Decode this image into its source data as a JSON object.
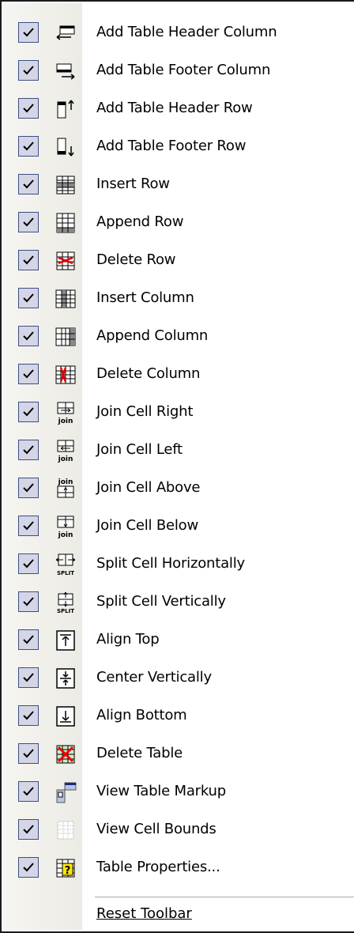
{
  "menu": {
    "items": [
      {
        "label": "Add Table Header Column",
        "icon": "add-header-column-icon",
        "checked": true
      },
      {
        "label": "Add Table Footer Column",
        "icon": "add-footer-column-icon",
        "checked": true
      },
      {
        "label": "Add Table Header Row",
        "icon": "add-header-row-icon",
        "checked": true
      },
      {
        "label": "Add Table Footer Row",
        "icon": "add-footer-row-icon",
        "checked": true
      },
      {
        "label": "Insert Row",
        "icon": "insert-row-icon",
        "checked": true
      },
      {
        "label": "Append Row",
        "icon": "append-row-icon",
        "checked": true
      },
      {
        "label": "Delete Row",
        "icon": "delete-row-icon",
        "checked": true
      },
      {
        "label": "Insert Column",
        "icon": "insert-column-icon",
        "checked": true
      },
      {
        "label": "Append Column",
        "icon": "append-column-icon",
        "checked": true
      },
      {
        "label": "Delete Column",
        "icon": "delete-column-icon",
        "checked": true
      },
      {
        "label": "Join Cell Right",
        "icon": "join-cell-right-icon",
        "checked": true
      },
      {
        "label": "Join Cell Left",
        "icon": "join-cell-left-icon",
        "checked": true
      },
      {
        "label": "Join Cell Above",
        "icon": "join-cell-above-icon",
        "checked": true
      },
      {
        "label": "Join Cell Below",
        "icon": "join-cell-below-icon",
        "checked": true
      },
      {
        "label": "Split Cell Horizontally",
        "icon": "split-cell-horizontally-icon",
        "checked": true
      },
      {
        "label": "Split Cell Vertically",
        "icon": "split-cell-vertically-icon",
        "checked": true
      },
      {
        "label": "Align Top",
        "icon": "align-top-icon",
        "checked": true
      },
      {
        "label": "Center Vertically",
        "icon": "center-vertically-icon",
        "checked": true
      },
      {
        "label": "Align Bottom",
        "icon": "align-bottom-icon",
        "checked": true
      },
      {
        "label": "Delete Table",
        "icon": "delete-table-icon",
        "checked": true
      },
      {
        "label": "View Table Markup",
        "icon": "view-table-markup-icon",
        "checked": true
      },
      {
        "label": "View Cell Bounds",
        "icon": "view-cell-bounds-icon",
        "checked": true
      },
      {
        "label": "Table Properties...",
        "icon": "table-properties-icon",
        "checked": true
      }
    ],
    "reset_label": "Reset Toolbar"
  },
  "colors": {
    "checkbox_fill": "#d4d5e6",
    "checkbox_border": "#3c4f83",
    "gutter": "#f0efea"
  }
}
